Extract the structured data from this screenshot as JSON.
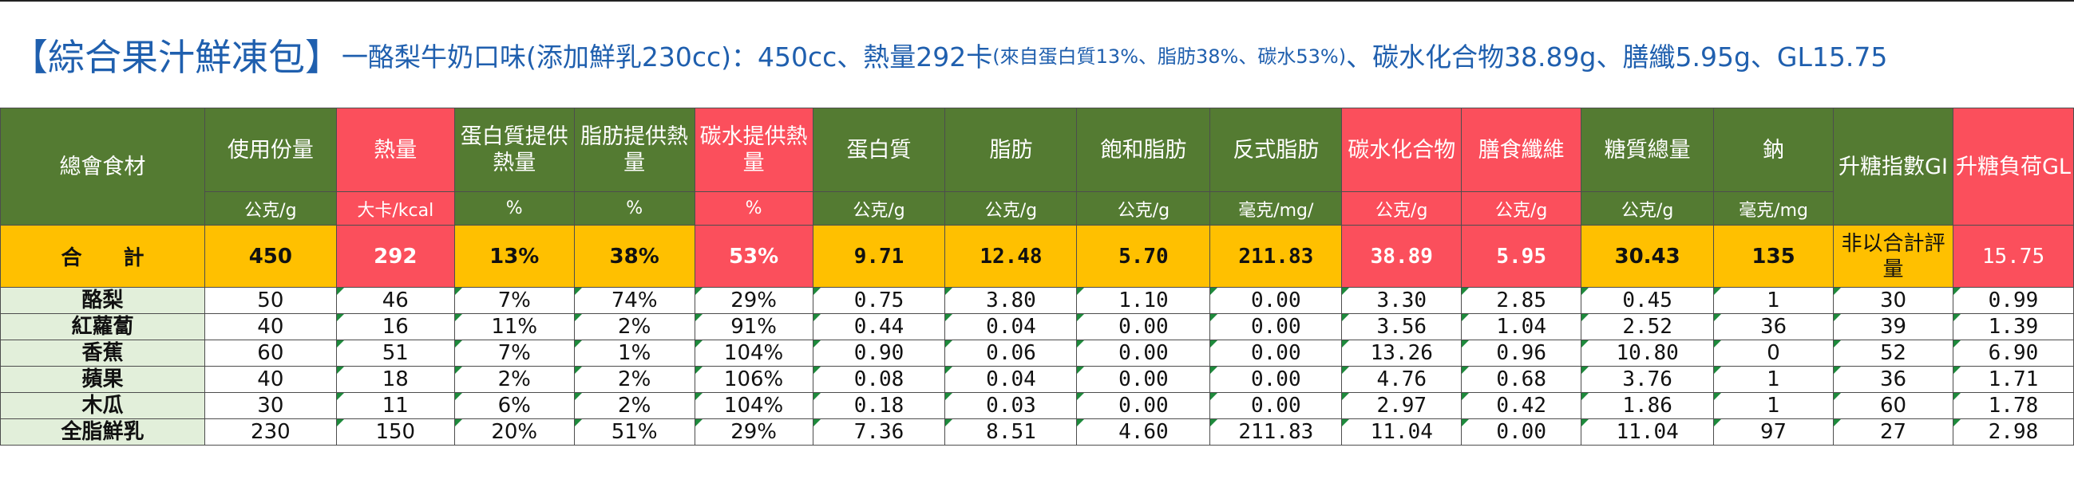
{
  "title": {
    "main": "【綜合果汁鮮凍包】",
    "product": "一酪梨牛奶口味(添加鮮乳230cc)：450cc、熱量292卡",
    "ratio": "(來自蛋白質13%、脂肪38%、碳水53%)",
    "tail": "、碳水化合物38.89g、膳纖5.95g、GL15.75"
  },
  "headers": [
    "總會食材",
    "使用份量",
    "熱量",
    "蛋白質提供熱量",
    "脂肪提供熱量",
    "碳水提供熱量",
    "蛋白質",
    "脂肪",
    "飽和脂肪",
    "反式脂肪",
    "碳水化合物",
    "膳食纖維",
    "糖質總量",
    "鈉",
    "升糖指數GI",
    "升糖負荷GL"
  ],
  "units": [
    "公克/g",
    "大卡/kcal",
    "%",
    "%",
    "%",
    "公克/g",
    "公克/g",
    "公克/g",
    "毫克/mg/",
    "公克/g",
    "公克/g",
    "公克/g",
    "毫克/mg"
  ],
  "total": {
    "label": "合　　計",
    "values": [
      "450",
      "292",
      "13%",
      "38%",
      "53%",
      "9.71",
      "12.48",
      "5.70",
      "211.83",
      "38.89",
      "5.95",
      "30.43",
      "135",
      "非以合計評量",
      "15.75"
    ]
  },
  "rows": [
    {
      "name": "酪梨",
      "values": [
        "50",
        "46",
        "7%",
        "74%",
        "29%",
        "0.75",
        "3.80",
        "1.10",
        "0.00",
        "3.30",
        "2.85",
        "0.45",
        "1",
        "30",
        "0.99"
      ]
    },
    {
      "name": "紅蘿蔔",
      "values": [
        "40",
        "16",
        "11%",
        "2%",
        "91%",
        "0.44",
        "0.04",
        "0.00",
        "0.00",
        "3.56",
        "1.04",
        "2.52",
        "36",
        "39",
        "1.39"
      ]
    },
    {
      "name": "香蕉",
      "values": [
        "60",
        "51",
        "7%",
        "1%",
        "104%",
        "0.90",
        "0.06",
        "0.00",
        "0.00",
        "13.26",
        "0.96",
        "10.80",
        "0",
        "52",
        "6.90"
      ]
    },
    {
      "name": "蘋果",
      "values": [
        "40",
        "18",
        "2%",
        "2%",
        "106%",
        "0.08",
        "0.04",
        "0.00",
        "0.00",
        "4.76",
        "0.68",
        "3.76",
        "1",
        "36",
        "1.71"
      ]
    },
    {
      "name": "木瓜",
      "values": [
        "30",
        "11",
        "6%",
        "2%",
        "104%",
        "0.18",
        "0.03",
        "0.00",
        "0.00",
        "2.97",
        "0.42",
        "1.86",
        "1",
        "60",
        "1.78"
      ]
    },
    {
      "name": "全脂鮮乳",
      "values": [
        "230",
        "150",
        "20%",
        "51%",
        "29%",
        "7.36",
        "8.51",
        "4.60",
        "211.83",
        "11.04",
        "0.00",
        "11.04",
        "97",
        "27",
        "2.98"
      ]
    }
  ],
  "colors": {
    "green_header": "#547b32",
    "red_header": "#fb4f5c",
    "total_row": "#ffc000",
    "name_cell": "#e2efda",
    "title_text": "#1f5fae"
  }
}
